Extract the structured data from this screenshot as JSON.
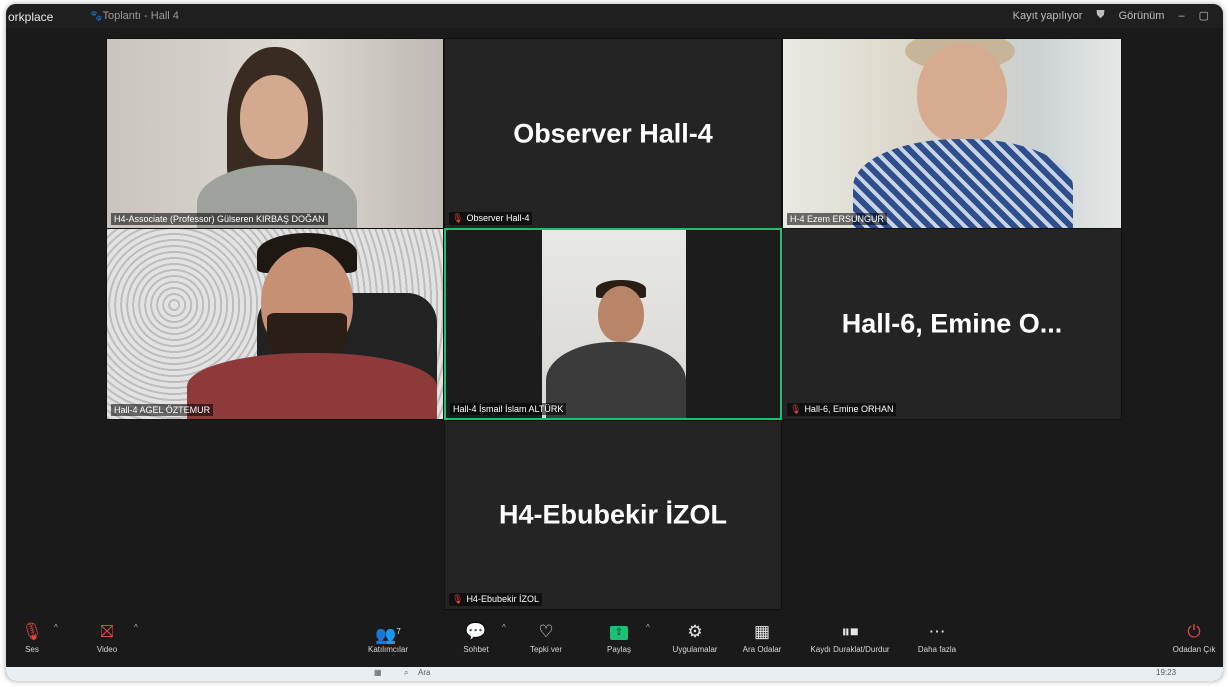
{
  "window": {
    "app_title": "orkplace",
    "meeting_title": "Toplantı - Hall 4",
    "status_left": "Kayıt yapılıyor",
    "status_view": "Görünüm",
    "accent_speaking": "#1dbf73",
    "mute_color": "#e2473f"
  },
  "tiles": [
    {
      "id": "t1",
      "big_name": "",
      "label": "H4-Associate (Professor) Gülseren KIRBAŞ DOĞAN",
      "muted": false,
      "has_video": true,
      "speaking": false
    },
    {
      "id": "t2",
      "big_name": "Observer Hall-4",
      "label": "Observer Hall-4",
      "muted": true,
      "has_video": false,
      "speaking": false
    },
    {
      "id": "t3",
      "big_name": "",
      "label": "H-4 Ezem ERSUNGUR",
      "muted": false,
      "has_video": true,
      "speaking": false
    },
    {
      "id": "t4",
      "big_name": "",
      "label": "Hall-4 AGEL ÖZTEMUR",
      "muted": false,
      "has_video": true,
      "speaking": false
    },
    {
      "id": "t5",
      "big_name": "",
      "label": "Hall-4 İsmail İslam ALTÜRK",
      "muted": false,
      "has_video": true,
      "speaking": true
    },
    {
      "id": "t6",
      "big_name": "Hall-6, Emine O...",
      "label": "Hall-6, Emine ORHAN",
      "muted": true,
      "has_video": false,
      "speaking": false
    },
    {
      "id": "t7",
      "big_name": "H4-Ebubekir İZOL",
      "label": "H4-Ebubekir İZOL",
      "muted": true,
      "has_video": false,
      "speaking": false
    }
  ],
  "toolbar": {
    "audio": {
      "label": "Ses",
      "icon": "mic-muted-icon"
    },
    "video": {
      "label": "Video",
      "icon": "video-off-icon"
    },
    "participants": {
      "label": "Katılımcılar",
      "icon": "participants-icon",
      "count": "7"
    },
    "chat": {
      "label": "Sohbet",
      "icon": "chat-icon"
    },
    "react": {
      "label": "Tepki ver",
      "icon": "heart-icon"
    },
    "share": {
      "label": "Paylaş",
      "icon": "share-icon"
    },
    "apps": {
      "label": "Uygulamalar",
      "icon": "apps-icon"
    },
    "breakout": {
      "label": "Ara Odalar",
      "icon": "breakout-icon"
    },
    "record": {
      "label": "Kaydı Duraklat/Durdur",
      "icon": "record-pause-stop-icon"
    },
    "more": {
      "label": "Daha fazla",
      "icon": "more-icon"
    },
    "leave": {
      "label": "Odadan Çık",
      "icon": "leave-icon"
    }
  },
  "taskbar": {
    "search_placeholder": "Ara",
    "time": "19:23"
  }
}
